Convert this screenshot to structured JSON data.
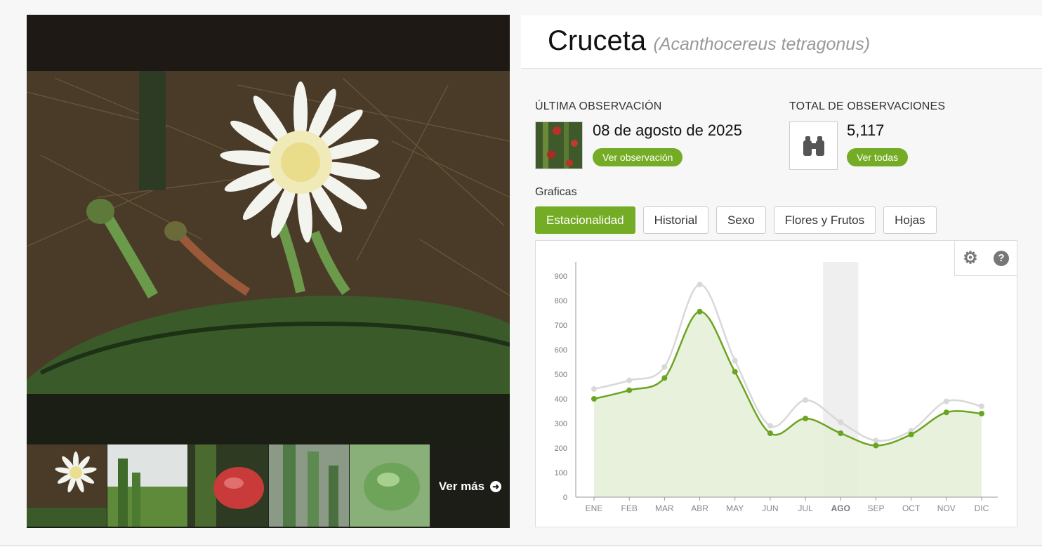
{
  "taxon": {
    "common_name": "Cruceta",
    "scientific_name": "(Acanthocereus tetragonus)"
  },
  "photos": {
    "see_more_label": "Ver más",
    "see_more_icon": "arrow-right-circle-icon",
    "thumbnails": [
      "flower",
      "plant",
      "red-fruit",
      "columnar-cactus",
      "green-fruit"
    ]
  },
  "last_observation": {
    "label": "ÚLTIMA OBSERVACIÓN",
    "date": "08 de agosto de 2025",
    "button_label": "Ver observación"
  },
  "total_observations": {
    "label": "TOTAL DE OBSERVACIONES",
    "count": "5,117",
    "button_label": "Ver todas",
    "icon": "binoculars-icon"
  },
  "charts_section": {
    "label": "Graficas",
    "tabs": [
      {
        "label": "Estacionalidad",
        "active": true
      },
      {
        "label": "Historial",
        "active": false
      },
      {
        "label": "Sexo",
        "active": false
      },
      {
        "label": "Flores y Frutos",
        "active": false
      },
      {
        "label": "Hojas",
        "active": false
      }
    ],
    "tools": {
      "gear_icon": "gear-icon",
      "help_icon": "help-circle-icon",
      "help_glyph": "?"
    }
  },
  "colors": {
    "accent": "#74ac25",
    "series_green": "#6ba421",
    "series_gray": "#d8d8d8",
    "area_fill": "#e4efd6"
  },
  "chart_data": {
    "type": "line",
    "categories": [
      "ENE",
      "FEB",
      "MAR",
      "ABR",
      "MAY",
      "JUN",
      "JUL",
      "AGO",
      "SEP",
      "OCT",
      "NOV",
      "DIC"
    ],
    "highlighted_category": "AGO",
    "ylim": [
      0,
      900
    ],
    "yticks": [
      0,
      100,
      200,
      300,
      400,
      500,
      600,
      700,
      800,
      900
    ],
    "series": [
      {
        "values": [
          440,
          475,
          530,
          865,
          555,
          290,
          395,
          305,
          230,
          270,
          390,
          370
        ],
        "color": "#d8d8d8",
        "filled": false
      },
      {
        "values": [
          400,
          435,
          485,
          755,
          510,
          260,
          320,
          260,
          210,
          255,
          345,
          340
        ],
        "color": "#6ba421",
        "filled": true
      }
    ],
    "grid": false,
    "legend": "none"
  }
}
